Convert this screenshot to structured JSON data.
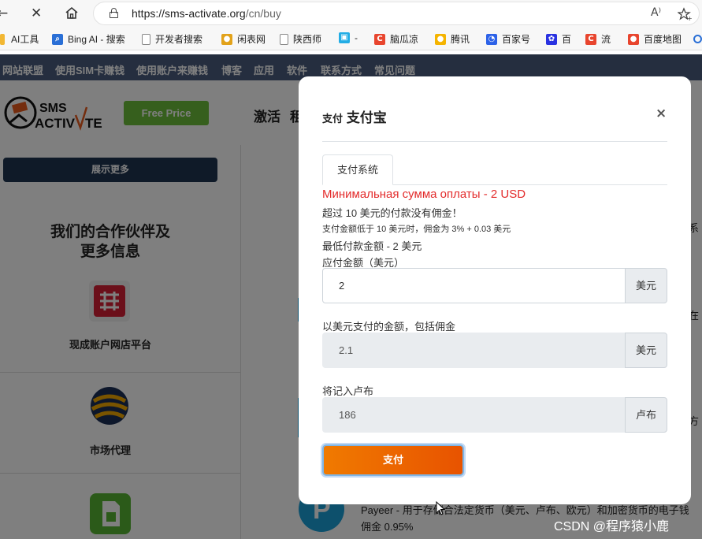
{
  "browser": {
    "url_host": "https://sms-activate.org",
    "url_path": "/cn/buy",
    "reader_icon": "A⁾",
    "bookmarks": [
      {
        "label": "AI工具",
        "icon": "folder-icon",
        "color": "#f2b733"
      },
      {
        "label": "Bing AI - 搜索",
        "icon": "search-icon",
        "color": "#2a6fd6"
      },
      {
        "label": "开发者搜索",
        "icon": "page-icon",
        "color": "#888888"
      },
      {
        "label": "闲表网",
        "icon": "medal-icon",
        "color": "#e2a21a"
      },
      {
        "label": "陕西师",
        "icon": "page-icon",
        "color": "#888888"
      },
      {
        "label": "-",
        "icon": "bilibili-icon",
        "color": "#23ade5"
      },
      {
        "label": "脑瓜凉",
        "icon": "c-icon",
        "color": "#e8452e"
      },
      {
        "label": "腾讯",
        "icon": "bell-icon",
        "color": "#f5b400"
      },
      {
        "label": "百家号",
        "icon": "baijia-icon",
        "color": "#2d62e8"
      },
      {
        "label": "百",
        "icon": "paw-icon",
        "color": "#2932e1"
      },
      {
        "label": "流",
        "icon": "c-icon",
        "color": "#e8452e"
      },
      {
        "label": "百度地图",
        "icon": "map-pin-icon",
        "color": "#e8452e"
      }
    ]
  },
  "site": {
    "nav": [
      "网站联盟",
      "使用SIM卡赚钱",
      "使用账户来赚钱",
      "博客",
      "应用",
      "软件",
      "联系方式",
      "常见问题"
    ],
    "free_price": "Free Price",
    "header_menu": [
      "激活",
      "租"
    ],
    "show_more": "展示更多",
    "partners_title_1": "我们的合作伙伴及",
    "partners_title_2": "更多信息",
    "partner_1": "现成账户网店平台",
    "partner_2": "市场代理",
    "payeer_text": "Payeer - 用于存储合法定货币（美元、卢布、欧元）和加密货币的电子钱",
    "payeer_fee": "佣金 0.95%",
    "edge_texts": [
      "系",
      "在",
      "方"
    ]
  },
  "modal": {
    "title_small": "支付",
    "title": "支付宝",
    "close": "×",
    "tab": "支付系统",
    "min_sum": "Минимальная сумма оплаты - 2 USD",
    "info_1": "超过 10 美元的付款没有佣金！",
    "info_2": "支付金额低于 10 美元时，佣金为 3% + 0.03 美元",
    "info_3": "最低付款金额 - 2 美元",
    "amount_label": "应付金额（美元）",
    "amount_value": "2",
    "amount_unit": "美元",
    "with_fee_label": "以美元支付的金额，包括佣金",
    "with_fee_value": "2.1",
    "with_fee_unit": "美元",
    "rub_label": "将记入卢布",
    "rub_value": "186",
    "rub_unit": "卢布",
    "pay_button": "支付"
  },
  "watermark": "CSDN @程序猿小鹿"
}
